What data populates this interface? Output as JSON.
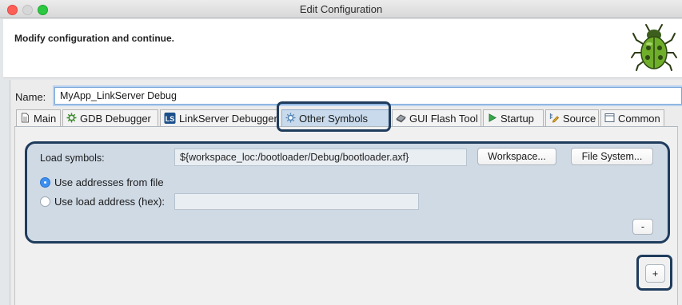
{
  "window": {
    "title": "Edit Configuration"
  },
  "header": {
    "message": "Modify configuration and continue."
  },
  "name_row": {
    "label": "Name:",
    "value": "MyApp_LinkServer Debug"
  },
  "tabs": [
    {
      "label": "Main",
      "icon": "document-icon"
    },
    {
      "label": "GDB Debugger",
      "icon": "bug-gear-icon"
    },
    {
      "label": "LinkServer Debugger",
      "icon": "ls-badge-icon",
      "badge": "LS"
    },
    {
      "label": "Other Symbols",
      "icon": "symbols-gear-icon",
      "active": true
    },
    {
      "label": "GUI Flash Tool",
      "icon": "chip-icon"
    },
    {
      "label": "Startup",
      "icon": "play-icon"
    },
    {
      "label": "Source",
      "icon": "source-lookup-icon"
    },
    {
      "label": "Common",
      "icon": "window-icon"
    }
  ],
  "symbols": {
    "load_label": "Load symbols:",
    "load_path": "${workspace_loc:/bootloader/Debug/bootloader.axf}",
    "workspace_button": "Workspace...",
    "file_system_button": "File System...",
    "radio_from_file": "Use addresses from file",
    "radio_load_address": "Use load address (hex):",
    "selected_option": "Use addresses from file",
    "remove_button": "-",
    "add_button": "+"
  },
  "colors": {
    "accent": "#3b8ff1",
    "highlight_outline": "#1f3c5c",
    "symbols_box_fill": "#cfdae5",
    "active_tab": "#c8daec"
  }
}
